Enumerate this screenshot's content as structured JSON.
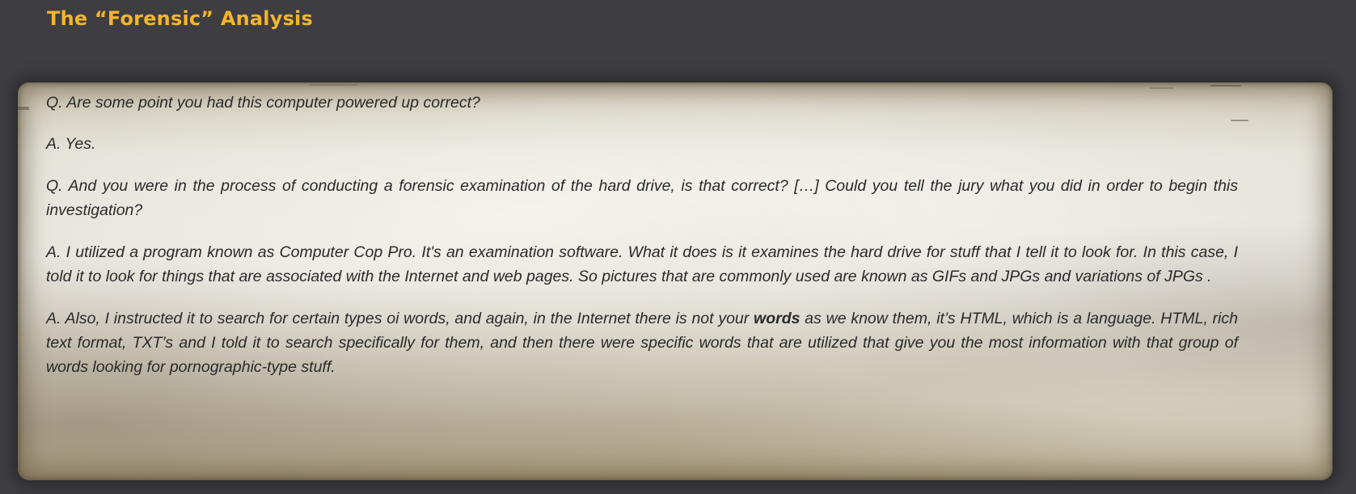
{
  "slide": {
    "title": "The “Forensic” Analysis"
  },
  "transcript": {
    "q1": "Q. Are some point you had this computer powered up correct?",
    "a1": "A. Yes.",
    "q2": "Q. And you were in the process of conducting a forensic examination of the hard drive, is that correct? […] Could you tell the jury what you did in order to begin this investigation?",
    "a2": "A. I utilized a program known as Computer Cop Pro. It's an examination software. What it does is it examines the hard drive for stuff that I tell it to look for. In this case, I told it to look for things that are associated with the Internet and web pages. So pictures that are commonly used are known as GIFs and JPGs and variations of JPGs .",
    "a3": {
      "before": "A. Also, I instructed it to search for certain types oi  words, and again, in the Internet there is not your ",
      "emphasis": "words",
      "after": " as we know them, it’s HTML, which is a language. HTML, rich text format, TXT’s and I told it to search specifically for them, and then there were specific words that are utilized that give you the most information with that group of words looking for pornographic-type stuff."
    }
  },
  "colors": {
    "background": "#3e3d42",
    "title": "#f4b52a",
    "text": "#2a2a2a"
  }
}
